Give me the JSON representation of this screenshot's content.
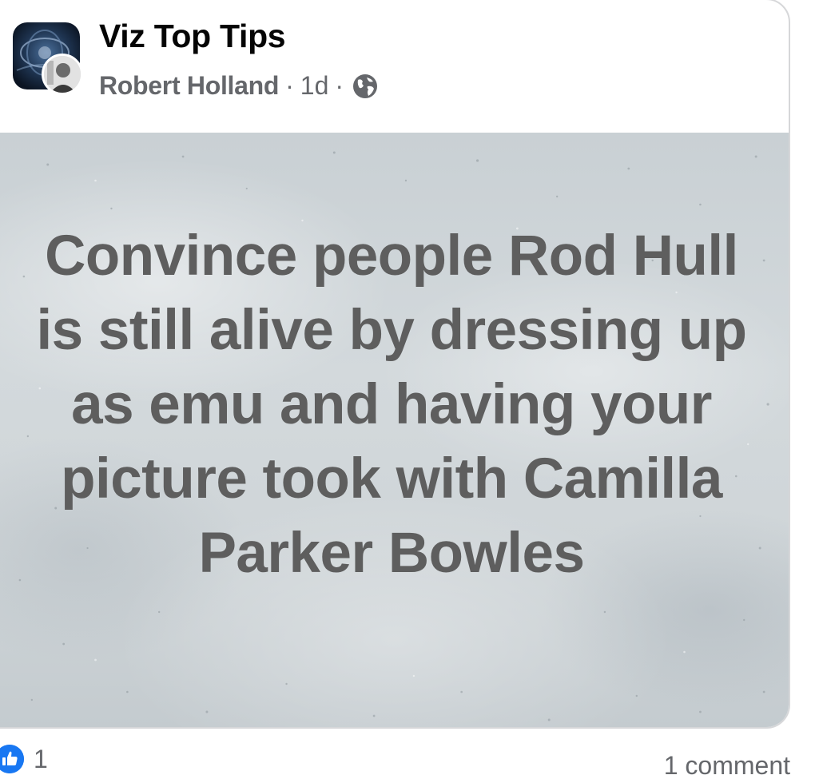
{
  "post": {
    "group_name": "Viz Top Tips",
    "author": "Robert Holland",
    "separator": "·",
    "age": "1d",
    "visibility_icon": "globe-icon",
    "text": "Convince people Rod Hull is still alive by dressing up as emu and having your picture took with Camilla Parker Bowles"
  },
  "footer": {
    "like_icon": "like-icon",
    "like_count": "1",
    "comment_count": "1 comment"
  },
  "colors": {
    "like_blue": "#1877f2",
    "meta_gray": "#65676b",
    "post_text": "#5e5e5e"
  }
}
